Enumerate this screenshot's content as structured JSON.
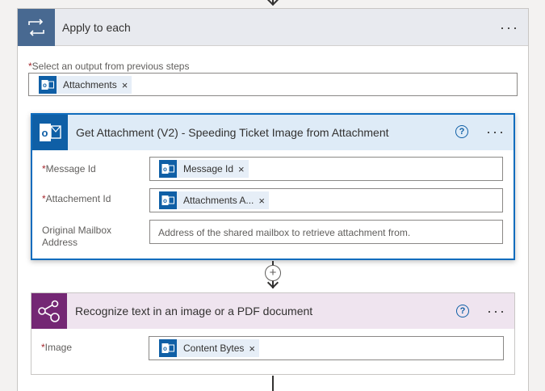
{
  "apply_to_each": {
    "title": "Apply to each",
    "select_output_label": "Select an output from previous steps",
    "select_output_token": "Attachments",
    "menu_icon": "more-options-icon",
    "icon": "loop-icon"
  },
  "get_attachment": {
    "title": "Get Attachment (V2) - Speeding Ticket Image from Attachment",
    "icon": "outlook-icon",
    "fields": [
      {
        "label": "Message Id",
        "required": true,
        "token": "Message Id"
      },
      {
        "label": "Attachement Id",
        "required": true,
        "token": "Attachments A..."
      },
      {
        "label_line1": "Original Mailbox",
        "label_line2": "Address",
        "required": false,
        "placeholder": "Address of the shared mailbox to retrieve attachment from."
      }
    ]
  },
  "recognize_text": {
    "title": "Recognize text in an image or a PDF document",
    "icon": "ai-builder-icon",
    "fields": [
      {
        "label": "Image",
        "required": true,
        "token": "Content Bytes"
      }
    ]
  },
  "required_marker": "*",
  "token_remove": "×",
  "help_glyph": "?",
  "add_step_glyph": "+",
  "menu_glyph": "···",
  "colors": {
    "apply_header_bg": "#e8eaef",
    "apply_icon_bg": "#486991",
    "outlook_blue": "#0f5fa6",
    "action_header_bg": "#deebf7",
    "ai_purple": "#742774",
    "ai_header_bg": "#efe4ef",
    "token_bg": "#e6eef7",
    "required_red": "#a4262c"
  }
}
